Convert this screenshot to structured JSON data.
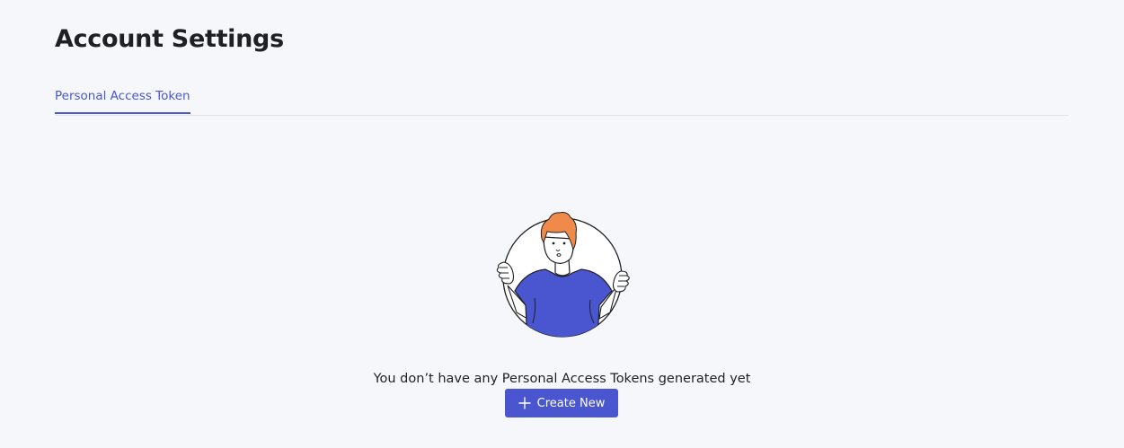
{
  "page": {
    "title": "Account Settings"
  },
  "tabs": [
    {
      "label": "Personal Access Token",
      "active": true
    }
  ],
  "empty_state": {
    "illustration_icon": "person-holding-circle-illustration",
    "message": "You don’t have any Personal Access Tokens generated yet",
    "create_button": {
      "label": "Create New",
      "icon": "plus-icon"
    }
  },
  "colors": {
    "accent": "#4a56cf",
    "background": "#f6f7fb",
    "hair": "#f08a4b",
    "divider": "#e2e4ea"
  }
}
